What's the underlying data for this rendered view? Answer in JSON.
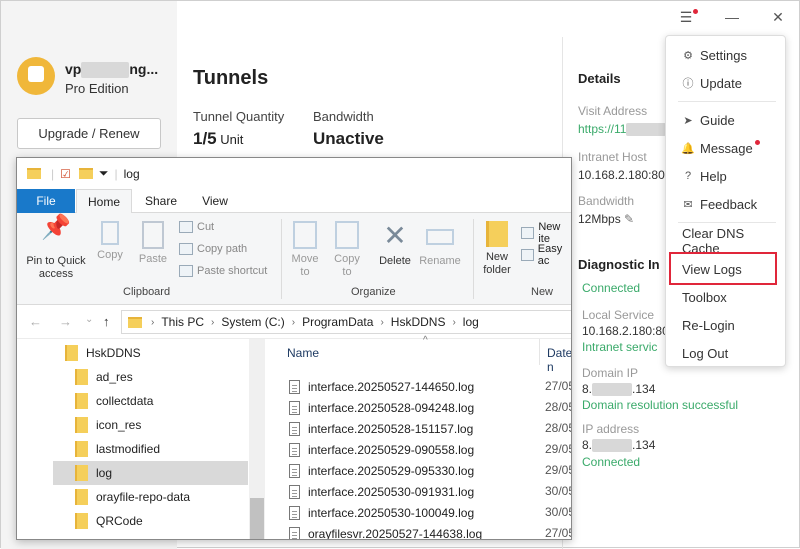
{
  "account": {
    "name_prefix": "vp",
    "name_suffix": "ng...",
    "edition": "Pro Edition",
    "upgrade_label": "Upgrade / Renew"
  },
  "tunnels": {
    "title": "Tunnels",
    "quantity_label": "Tunnel Quantity",
    "quantity_value": "1/5",
    "quantity_unit": "Unit",
    "bandwidth_label": "Bandwidth",
    "bandwidth_value": "Unactive"
  },
  "details": {
    "title": "Details",
    "visit_address_label": "Visit Address",
    "visit_address_value": "https://11",
    "intranet_host_label": "Intranet Host",
    "intranet_host_value": "10.168.2.180:80",
    "bandwidth_label": "Bandwidth",
    "bandwidth_value": "12Mbps",
    "diagnostic_title": "Diagnostic In",
    "connected_1": "Connected",
    "local_service_label": "Local Service",
    "local_service_value": "10.168.2.180:80",
    "intranet_service": "Intranet servic",
    "domain_ip_label": "Domain IP",
    "domain_ip_prefix": "8.",
    "domain_ip_suffix": ".134",
    "domain_ok": "Domain resolution successful",
    "ip_address_label": "IP address",
    "ip_prefix": "8.",
    "ip_suffix": ".134",
    "connected_2": "Connected"
  },
  "menu": {
    "items": [
      "Settings",
      "Update",
      "Guide",
      "Message",
      "Help",
      "Feedback",
      "Clear DNS Cache",
      "View Logs",
      "Toolbox",
      "Re-Login",
      "Log Out"
    ]
  },
  "explorer": {
    "title": "log",
    "tabs": [
      "File",
      "Home",
      "Share",
      "View"
    ],
    "ribbon": {
      "pin": "Pin to Quick access",
      "copy": "Copy",
      "paste": "Paste",
      "cut": "Cut",
      "copy_path": "Copy path",
      "paste_shortcut": "Paste shortcut",
      "clipboard": "Clipboard",
      "move_to": "Move to",
      "copy_to": "Copy to",
      "delete": "Delete",
      "rename": "Rename",
      "organize": "Organize",
      "new_folder": "New folder",
      "new_item": "New ite",
      "easy_access": "Easy ac",
      "new": "New"
    },
    "path": [
      "This PC",
      "System (C:)",
      "ProgramData",
      "HskDDNS",
      "log"
    ],
    "tree": [
      "HskDDNS",
      "ad_res",
      "collectdata",
      "icon_res",
      "lastmodified",
      "log",
      "orayfile-repo-data",
      "QRCode"
    ],
    "columns": {
      "name": "Name",
      "date": "Date n"
    },
    "files": [
      {
        "name": "interface.20250527-144650.log",
        "date": "27/05"
      },
      {
        "name": "interface.20250528-094248.log",
        "date": "28/05"
      },
      {
        "name": "interface.20250528-151157.log",
        "date": "28/05"
      },
      {
        "name": "interface.20250529-090558.log",
        "date": "29/05"
      },
      {
        "name": "interface.20250529-095330.log",
        "date": "29/05"
      },
      {
        "name": "interface.20250530-091931.log",
        "date": "30/05"
      },
      {
        "name": "interface.20250530-100049.log",
        "date": "30/05"
      },
      {
        "name": "orayfilesvr.20250527-144638.log",
        "date": "27/05"
      }
    ]
  }
}
